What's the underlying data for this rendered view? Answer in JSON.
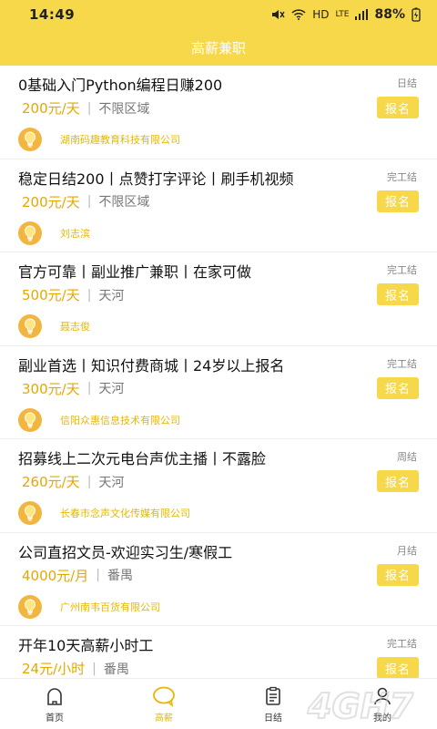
{
  "status": {
    "time": "14:49",
    "network": "HD",
    "lte": "LTE",
    "battery": "88%"
  },
  "header": {
    "title": "高薪兼职"
  },
  "jobs": [
    {
      "title": "0基础入门Python编程日赚200",
      "settle": "日结",
      "salary": "200元/天",
      "area": "不限区域",
      "apply": "报名",
      "company": "湖南码趣教育科技有限公司"
    },
    {
      "title": "稳定日结200丨点赞打字评论丨刷手机视频",
      "settle": "完工结",
      "salary": "200元/天",
      "area": "不限区域",
      "apply": "报名",
      "company": "刘志滨"
    },
    {
      "title": "官方可靠丨副业推广兼职丨在家可做",
      "settle": "完工结",
      "salary": "500元/天",
      "area": "天河",
      "apply": "报名",
      "company": "聂志俊"
    },
    {
      "title": "副业首选丨知识付费商城丨24岁以上报名",
      "settle": "完工结",
      "salary": "300元/天",
      "area": "天河",
      "apply": "报名",
      "company": "信阳众惠信息技术有限公司"
    },
    {
      "title": "招募线上二次元电台声优主播丨不露脸",
      "settle": "周结",
      "salary": "260元/天",
      "area": "天河",
      "apply": "报名",
      "company": "长春市念声文化传媒有限公司"
    },
    {
      "title": "公司直招文员-欢迎实习生/寒假工",
      "settle": "月结",
      "salary": "4000元/月",
      "area": "番禺",
      "apply": "报名",
      "company": "广州南韦百货有限公司"
    },
    {
      "title": "开年10天高薪小时工",
      "settle": "完工结",
      "salary": "24元/小时",
      "area": "番禺",
      "apply": "报名",
      "company": ""
    }
  ],
  "tabbar": {
    "items": [
      {
        "label": "首页",
        "icon": "home-icon"
      },
      {
        "label": "高薪",
        "icon": "chat-bubble-icon"
      },
      {
        "label": "日结",
        "icon": "clipboard-icon"
      },
      {
        "label": "我的",
        "icon": "user-icon"
      }
    ],
    "active_index": 1
  },
  "colors": {
    "brand_yellow": "#f7d84a",
    "salary": "#e6a700",
    "company": "#e6b800",
    "bulb": "#f2b640"
  }
}
